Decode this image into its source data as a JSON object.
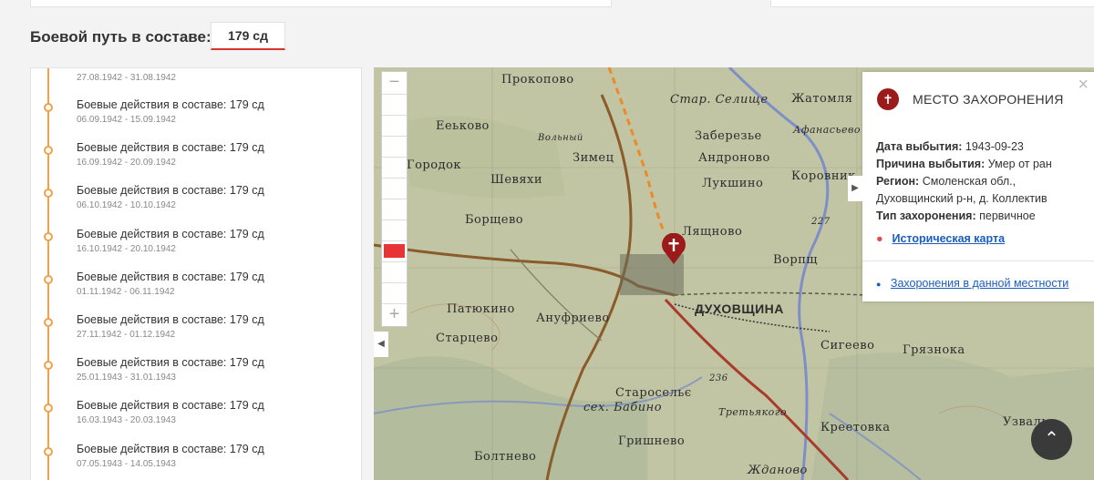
{
  "header": {
    "combat_path_label": "Боевой путь в составе:",
    "division_value": "179 сд"
  },
  "timeline": {
    "first_dates": "27.08.1942 - 31.08.1942",
    "items": [
      {
        "title": "Боевые действия в составе: 179 сд",
        "dates": "06.09.1942 - 15.09.1942"
      },
      {
        "title": "Боевые действия в составе: 179 сд",
        "dates": "16.09.1942 - 20.09.1942"
      },
      {
        "title": "Боевые действия в составе: 179 сд",
        "dates": "06.10.1942 - 10.10.1942"
      },
      {
        "title": "Боевые действия в составе: 179 сд",
        "dates": "16.10.1942 - 20.10.1942"
      },
      {
        "title": "Боевые действия в составе: 179 сд",
        "dates": "01.11.1942 - 06.11.1942"
      },
      {
        "title": "Боевые действия в составе: 179 сд",
        "dates": "27.11.1942 - 01.12.1942"
      },
      {
        "title": "Боевые действия в составе: 179 сд",
        "dates": "25.01.1943 - 31.01.1943"
      },
      {
        "title": "Боевые действия в составе: 179 сд",
        "dates": "16.03.1943 - 20.03.1943"
      },
      {
        "title": "Боевые действия в составе: 179 сд",
        "dates": "07.05.1943 - 14.05.1943"
      }
    ]
  },
  "map": {
    "zoom_in": "+",
    "zoom_out": "−",
    "labels": [
      "Прокопово",
      "Ееьково",
      "Стар. Селище",
      "Жатомля",
      "Заберезье",
      "Афанасьево",
      "Андроново",
      "Городок",
      "Шевяхи",
      "Зимец",
      "Лукшино",
      "Коровник",
      "Борщево",
      "Лящново",
      "Ворпщ",
      "Патюкино",
      "Ануфриево",
      "ДУХОВЩИНА",
      "Старцево",
      "Сигеево",
      "Грязнока",
      "Старосельє",
      "сех. Бабино",
      "Третьякого",
      "Креетовка",
      "Гришнево",
      "Болтнево",
      "Жданово",
      "Узвалье",
      "Вольный",
      "227",
      "236"
    ]
  },
  "burial_popup": {
    "title": "МЕСТО ЗАХОРОНЕНИЯ",
    "icon": "cross-icon",
    "fields": {
      "date_label": "Дата выбытия:",
      "date_value": "1943-09-23",
      "reason_label": "Причина выбытия:",
      "reason_value": "Умер от ран",
      "region_label": "Регион:",
      "region_value": "Смоленская обл., Духовщинский р-н, д. Коллектив",
      "type_label": "Тип захоронения:",
      "type_value": "первичное"
    },
    "historical_map_link": "Историческая карта",
    "nearby_link": "Захоронения в данной местности"
  },
  "colors": {
    "accent_red": "#d6342c",
    "timeline_orange": "#f0a24a",
    "marker_dark_red": "#9b1b1b",
    "link_blue": "#1a5dbf"
  }
}
